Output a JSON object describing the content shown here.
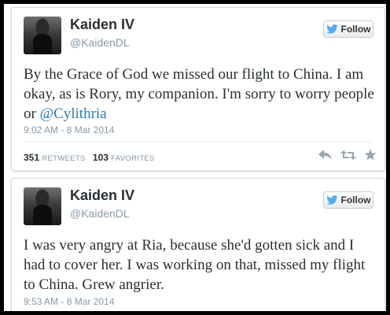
{
  "tweets": [
    {
      "name": "Kaiden IV",
      "handle": "@KaidenDL",
      "follow_label": "Follow",
      "text_main": "By the Grace of God we missed our flight to China. I am okay, as is Rory, my companion. I'm sorry to worry people or ",
      "mention": "@Cylithria",
      "timestamp": "9:02 AM - 8 Mar 2014",
      "retweets_count": "351",
      "retweets_label": "RETWEETS",
      "favorites_count": "103",
      "favorites_label": "FAVORITES"
    },
    {
      "name": "Kaiden IV",
      "handle": "@KaidenDL",
      "follow_label": "Follow",
      "text_main": "I was very angry at Ria, because she'd gotten sick and I had to cover her. I was working on that, missed my flight to China. Grew angrier.",
      "timestamp": "9:53 AM - 8 Mar 2014"
    }
  ],
  "colors": {
    "link": "#2b7bb9",
    "bird_blue": "#55acee",
    "muted": "#8899a6",
    "icon_gray": "#9aa6b0"
  },
  "icons": [
    "twitter-bird-icon",
    "reply-icon",
    "retweet-icon",
    "favorite-star-icon"
  ]
}
